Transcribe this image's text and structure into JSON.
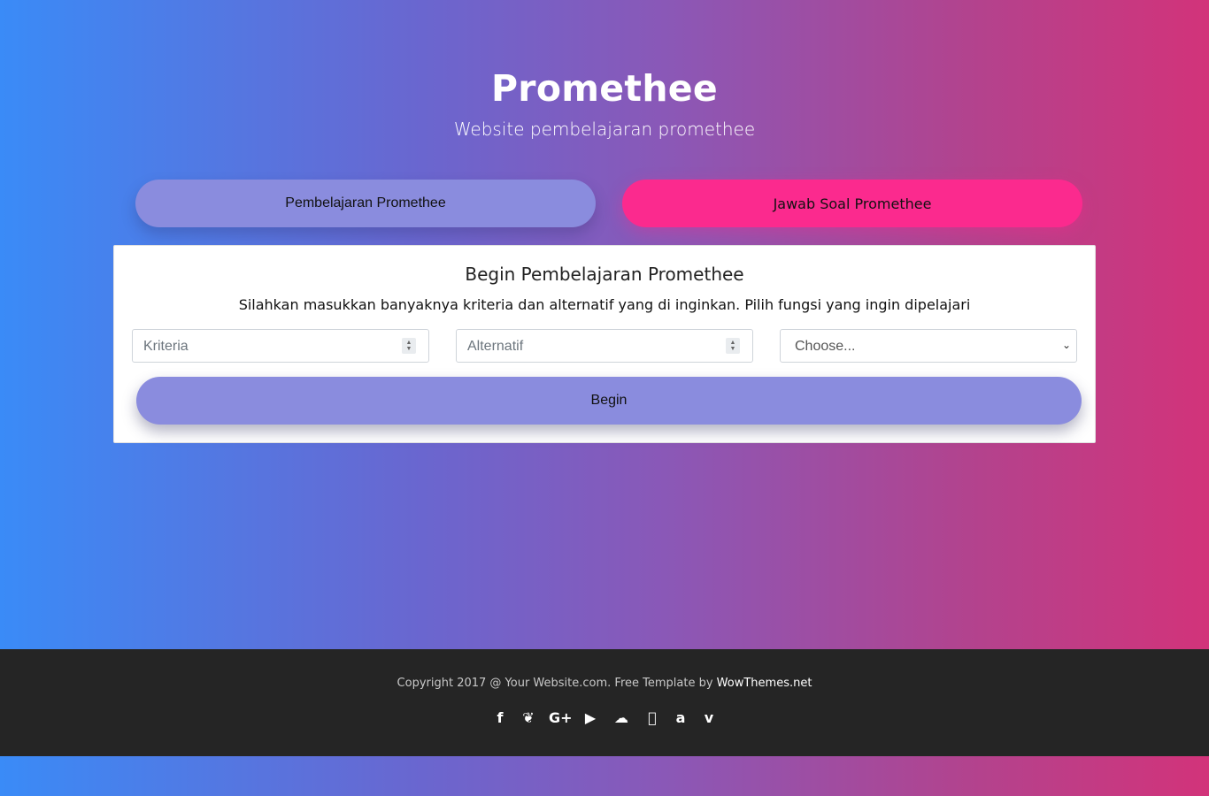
{
  "header": {
    "title": "Promethee",
    "subtitle": "Website pembelajaran promethee"
  },
  "nav": {
    "learn_label": "Pembelajaran Promethee",
    "answer_label": "Jawab Soal Promethee"
  },
  "card": {
    "title": "Begin Pembelajaran Promethee",
    "description": "Silahkan masukkan banyaknya kriteria dan alternatif yang di inginkan. Pilih fungsi yang ingin dipelajari",
    "kriteria_placeholder": "Kriteria",
    "alternatif_placeholder": "Alternatif",
    "select_value": "Choose...",
    "begin_label": "Begin"
  },
  "footer": {
    "copyright": "Copyright 2017 @ Your Website.com. Free Template by ",
    "brand": "WowThemes.net",
    "social_icons": [
      "facebook-icon",
      "twitter-icon",
      "google-plus-icon",
      "youtube-icon",
      "soundcloud-icon",
      "apple-icon",
      "amazon-icon",
      "vimeo-icon"
    ]
  },
  "colors": {
    "gradient_start": "#3a8bf7",
    "gradient_end": "#d2337a",
    "learn_button": "#8a8cde",
    "answer_button": "#fb2a8e",
    "footer_bg": "#252525"
  }
}
